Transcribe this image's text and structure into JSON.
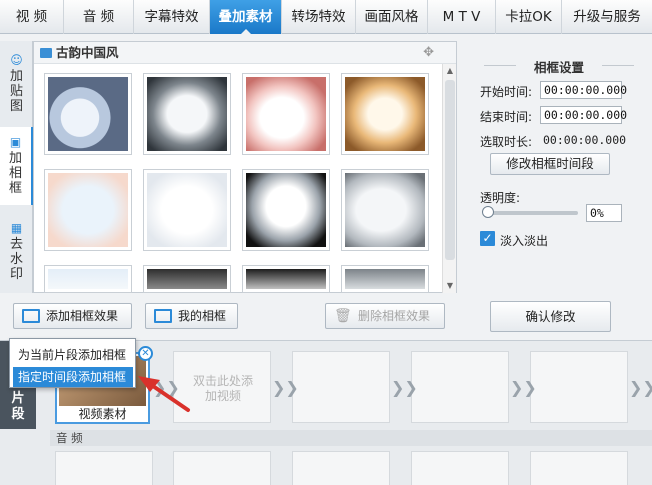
{
  "top_tabs": [
    {
      "label": "视  频",
      "active": false
    },
    {
      "label": "音  频",
      "active": false
    },
    {
      "label": "字幕特效",
      "active": false
    },
    {
      "label": "叠加素材",
      "active": true
    },
    {
      "label": "转场特效",
      "active": false
    },
    {
      "label": "画面风格",
      "active": false
    },
    {
      "label": "M T V",
      "active": false
    },
    {
      "label": "卡拉OK",
      "active": false
    },
    {
      "label": "升级与服务",
      "active": false
    }
  ],
  "left_tabs": [
    {
      "label": "加贴图",
      "icon": "sticker-icon",
      "active": false
    },
    {
      "label": "加相框",
      "icon": "frame-icon",
      "active": true
    },
    {
      "label": "去水印",
      "icon": "watermark-icon",
      "active": false
    }
  ],
  "panel": {
    "title": "古韵中国风",
    "thumb_count": 12
  },
  "toolbar": {
    "add_frame_label": "添加相框效果",
    "my_frames_label": "我的相框",
    "delete_frame_label": "删除相框效果"
  },
  "settings": {
    "title": "相框设置",
    "start_label": "开始时间:",
    "start_value": "00:00:00.000",
    "end_label": "结束时间:",
    "end_value": "00:00:00.000",
    "duration_label": "选取时长:",
    "duration_value": "00:00:00.000",
    "modify_segment_label": "修改相框时间段",
    "opacity_label": "透明度:",
    "opacity_value": "0%",
    "opacity_level": 0,
    "fade_label": "淡入淡出",
    "fade_checked": true,
    "confirm_label": "确认修改"
  },
  "popup": {
    "item1": "为当前片段添加相框",
    "item2": "指定时间段添加相框"
  },
  "timeline": {
    "side_label": "片段",
    "clip_caption": "视频素材",
    "empty_hint": "双击此处添加视频",
    "audio_label": "音  频"
  },
  "colors": {
    "accent": "#2b8ad8",
    "active_tab": "#1a78c8",
    "annotation_arrow": "#d9312b"
  }
}
